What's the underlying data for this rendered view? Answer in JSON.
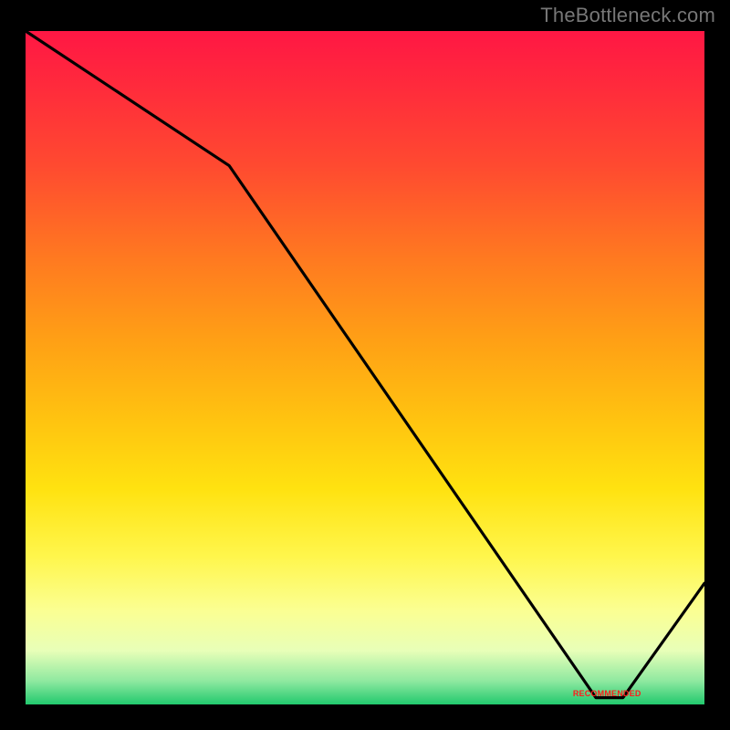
{
  "attribution": "TheBottleneck.com",
  "chart_data": {
    "type": "line",
    "title": "",
    "xlabel": "",
    "ylabel": "",
    "xlim": [
      0,
      100
    ],
    "ylim": [
      0,
      100
    ],
    "x": [
      0,
      30,
      84,
      88,
      100
    ],
    "values": [
      100,
      80,
      1,
      1,
      18
    ],
    "min_segment": {
      "x_start": 82,
      "x_end": 90,
      "y": 1
    },
    "annotations": [
      {
        "text": "RECOMMENDED",
        "x": 86,
        "y": 1,
        "color": "#ff1a1a"
      }
    ]
  },
  "colors": {
    "line": "#000000",
    "marker_text": "#ff1a1a"
  }
}
